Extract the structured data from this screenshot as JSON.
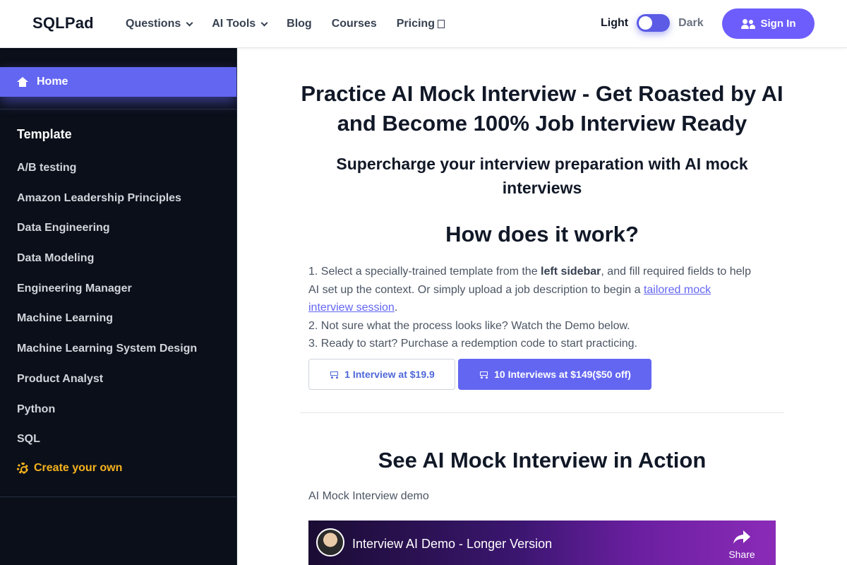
{
  "header": {
    "logo": "SQLPad",
    "nav": [
      {
        "label": "Questions"
      },
      {
        "label": "AI Tools"
      },
      {
        "label": "Blog"
      },
      {
        "label": "Courses"
      },
      {
        "label": "Pricing"
      }
    ],
    "theme_light": "Light",
    "theme_dark": "Dark",
    "signin_label": "Sign In"
  },
  "sidebar": {
    "home_label": "Home",
    "section_title": "Template",
    "items": [
      {
        "label": "A/B testing"
      },
      {
        "label": "Amazon Leadership Principles"
      },
      {
        "label": "Data Engineering"
      },
      {
        "label": "Data Modeling"
      },
      {
        "label": "Engineering Manager"
      },
      {
        "label": "Machine Learning"
      },
      {
        "label": "Machine Learning System Design"
      },
      {
        "label": "Product Analyst"
      },
      {
        "label": "Python"
      },
      {
        "label": "SQL"
      }
    ],
    "create_label": "Create your own"
  },
  "main": {
    "title": "Practice AI Mock Interview - Get Roasted by AI and Become 100% Job Interview Ready",
    "subtitle": "Supercharge your interview preparation with AI mock interviews",
    "how_title": "How does it work?",
    "step1_pre": "1. Select a specially-trained template from the ",
    "step1_bold": "left sidebar",
    "step1_mid": ", and fill required fields to help AI set up the context. Or simply upload a job description to begin a ",
    "step1_link": "tailored mock interview session",
    "step1_end": ".",
    "step2": "2. Not sure what the process looks like? Watch the Demo below.",
    "step3": "3. Ready to start? Purchase a redemption code to start practicing.",
    "buy_one": "1 Interview at $19.9",
    "buy_ten": "10 Interviews at $149($50 off)",
    "action_title": "See AI Mock Interview in Action",
    "demo_label": "AI Mock Interview demo",
    "video": {
      "title": "Interview AI Demo - Longer Version",
      "share_label": "Share"
    }
  },
  "colors": {
    "accent": "#6366f1",
    "sidebar_bg": "#0b0f19",
    "create_color": "#f5b21f"
  }
}
